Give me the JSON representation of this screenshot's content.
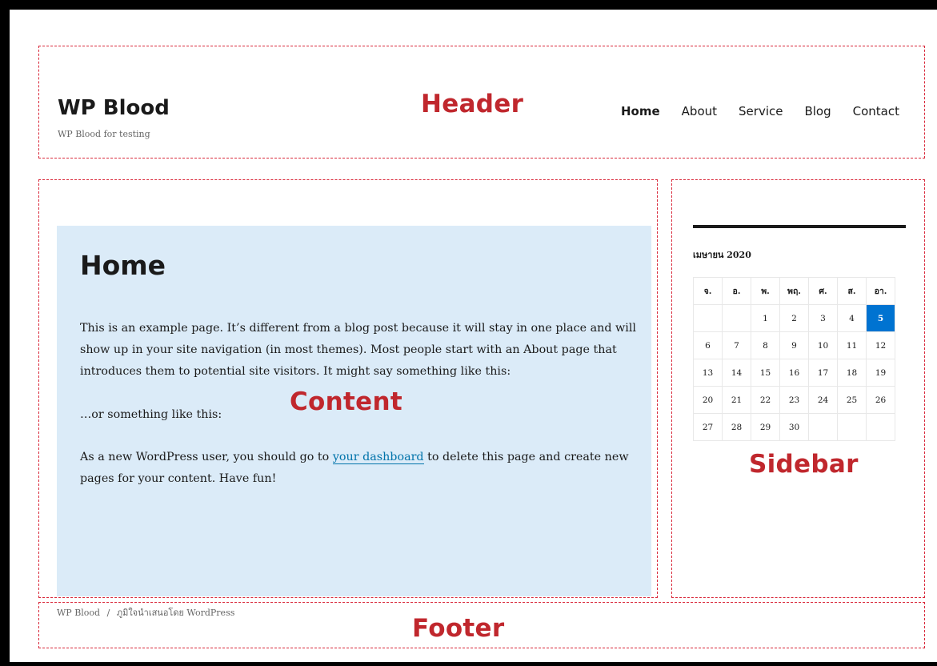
{
  "header": {
    "site_title": "WP Blood",
    "site_description": "WP Blood for testing",
    "region_label": "Header",
    "nav": [
      "Home",
      "About",
      "Service",
      "Blog",
      "Contact"
    ]
  },
  "content": {
    "region_label": "Content",
    "title": "Home",
    "para1": "This is an example page. It’s different from a blog post because it will stay in one place and will show up in your site navigation (in most themes). Most people start with an About page that introduces them to potential site visitors. It might say something like this:",
    "para2": "…or something like this:",
    "para3_before": "As a new WordPress user, you should go to ",
    "para3_link": "your dashboard",
    "para3_after": " to delete this page and create new pages for your content. Have fun!"
  },
  "sidebar": {
    "region_label": "Sidebar",
    "calendar": {
      "caption": "เมษายน 2020",
      "headers": [
        "จ.",
        "อ.",
        "พ.",
        "พฤ.",
        "ศ.",
        "ส.",
        "อา."
      ],
      "rows": [
        [
          "",
          "",
          "1",
          "2",
          "3",
          "4",
          "5"
        ],
        [
          "6",
          "7",
          "8",
          "9",
          "10",
          "11",
          "12"
        ],
        [
          "13",
          "14",
          "15",
          "16",
          "17",
          "18",
          "19"
        ],
        [
          "20",
          "21",
          "22",
          "23",
          "24",
          "25",
          "26"
        ],
        [
          "27",
          "28",
          "29",
          "30",
          "",
          "",
          ""
        ]
      ],
      "today": "5"
    }
  },
  "footer": {
    "region_label": "Footer",
    "site_link": "WP Blood",
    "separator": "/",
    "credit": "ภูมิใจนำเสนอโดย WordPress"
  },
  "colors": {
    "region_border": "#d9283a",
    "label_red": "#c0272d",
    "content_bg": "#dbebf8",
    "today_bg": "#0073d1",
    "link": "#0073aa"
  }
}
